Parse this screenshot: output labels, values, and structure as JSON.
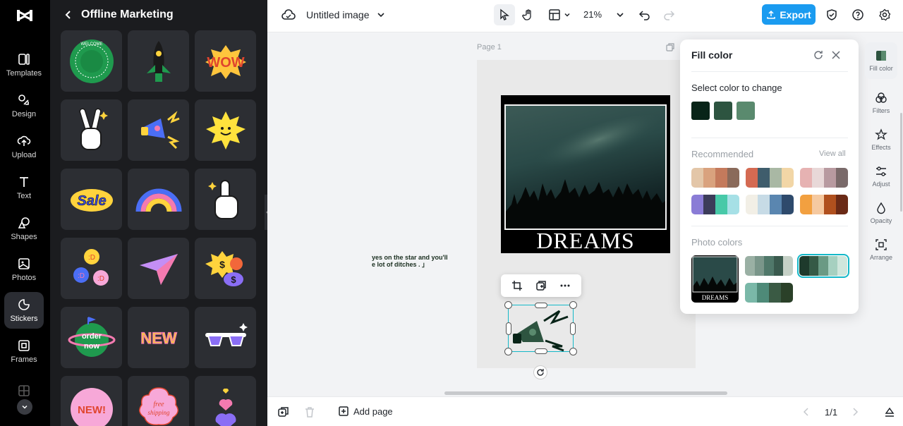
{
  "rail": {
    "items": [
      {
        "label": "Templates",
        "icon": "templates-icon"
      },
      {
        "label": "Design",
        "icon": "design-icon"
      },
      {
        "label": "Upload",
        "icon": "upload-icon"
      },
      {
        "label": "Text",
        "icon": "text-icon"
      },
      {
        "label": "Shapes",
        "icon": "shapes-icon"
      },
      {
        "label": "Photos",
        "icon": "photos-icon"
      },
      {
        "label": "Stickers",
        "icon": "stickers-icon",
        "active": true
      },
      {
        "label": "Frames",
        "icon": "frames-icon"
      },
      {
        "label": "Collage",
        "icon": "collage-icon"
      }
    ]
  },
  "panel": {
    "title": "Offline Marketing",
    "stickers": {
      "welcome": "WELCOME",
      "wow": "WOW",
      "sale": "Sale",
      "d1": ":D",
      "d2": ":D",
      "d3": ":D",
      "dollar": "$",
      "order": "order",
      "now": "now",
      "new": "NEW",
      "new_excl": "NEW!",
      "free": "free",
      "shipping": "shipping"
    }
  },
  "topbar": {
    "doc_title": "Untitled image",
    "zoom": "21%",
    "export_label": "Export"
  },
  "canvas": {
    "page_label": "Page 1",
    "poster_title": "DREAMS",
    "quote_line1": "yes on the star and you'll",
    "quote_line2": "e lot of ditches . 」"
  },
  "fill_panel": {
    "title": "Fill color",
    "select_label": "Select color to change",
    "selected_colors": [
      "#082418",
      "#2d5440",
      "#5a8a6e"
    ],
    "recommended_label": "Recommended",
    "view_all": "View all",
    "recommended": [
      [
        "#e3c6a8",
        "#d9a27e",
        "#c47a5c",
        "#8a6a5a"
      ],
      [
        "#d46a52",
        "#3f5d6c",
        "#a9b8a4",
        "#f2d6a6"
      ],
      [
        "#e6b2b2",
        "#e8d8d8",
        "#b89aa0",
        "#7a6a6a"
      ],
      [
        "#8a7cd6",
        "#3c3c5a",
        "#47c9a8",
        "#a6e0e6"
      ],
      [
        "#f2efe6",
        "#c7dbe6",
        "#5a86b0",
        "#2e4a6c"
      ],
      [
        "#f2a040",
        "#f5c9a0",
        "#b0501e",
        "#6a2a16"
      ]
    ],
    "photo_label": "Photo colors",
    "photo_title": "DREAMS",
    "photo_palettes": [
      [
        "#9ab0a4",
        "#7a968a",
        "#50786a",
        "#3a5a4e",
        "#c5d0c6"
      ],
      [
        "#1e3a2c",
        "#355a46",
        "#6a9a84",
        "#a6d0c0",
        "#cfe6dc"
      ],
      [
        "#7ab8a8",
        "#4e8a78",
        "#3a5a44",
        "#2a4028"
      ]
    ]
  },
  "right_rail": {
    "items": [
      {
        "label": "Fill color",
        "icon": "fill-color-icon",
        "active": true
      },
      {
        "label": "Filters",
        "icon": "filters-icon"
      },
      {
        "label": "Effects",
        "icon": "effects-icon"
      },
      {
        "label": "Adjust",
        "icon": "adjust-icon"
      },
      {
        "label": "Opacity",
        "icon": "opacity-icon"
      },
      {
        "label": "Arrange",
        "icon": "arrange-icon"
      }
    ]
  },
  "bottombar": {
    "add_page": "Add page",
    "pager": "1/1"
  }
}
